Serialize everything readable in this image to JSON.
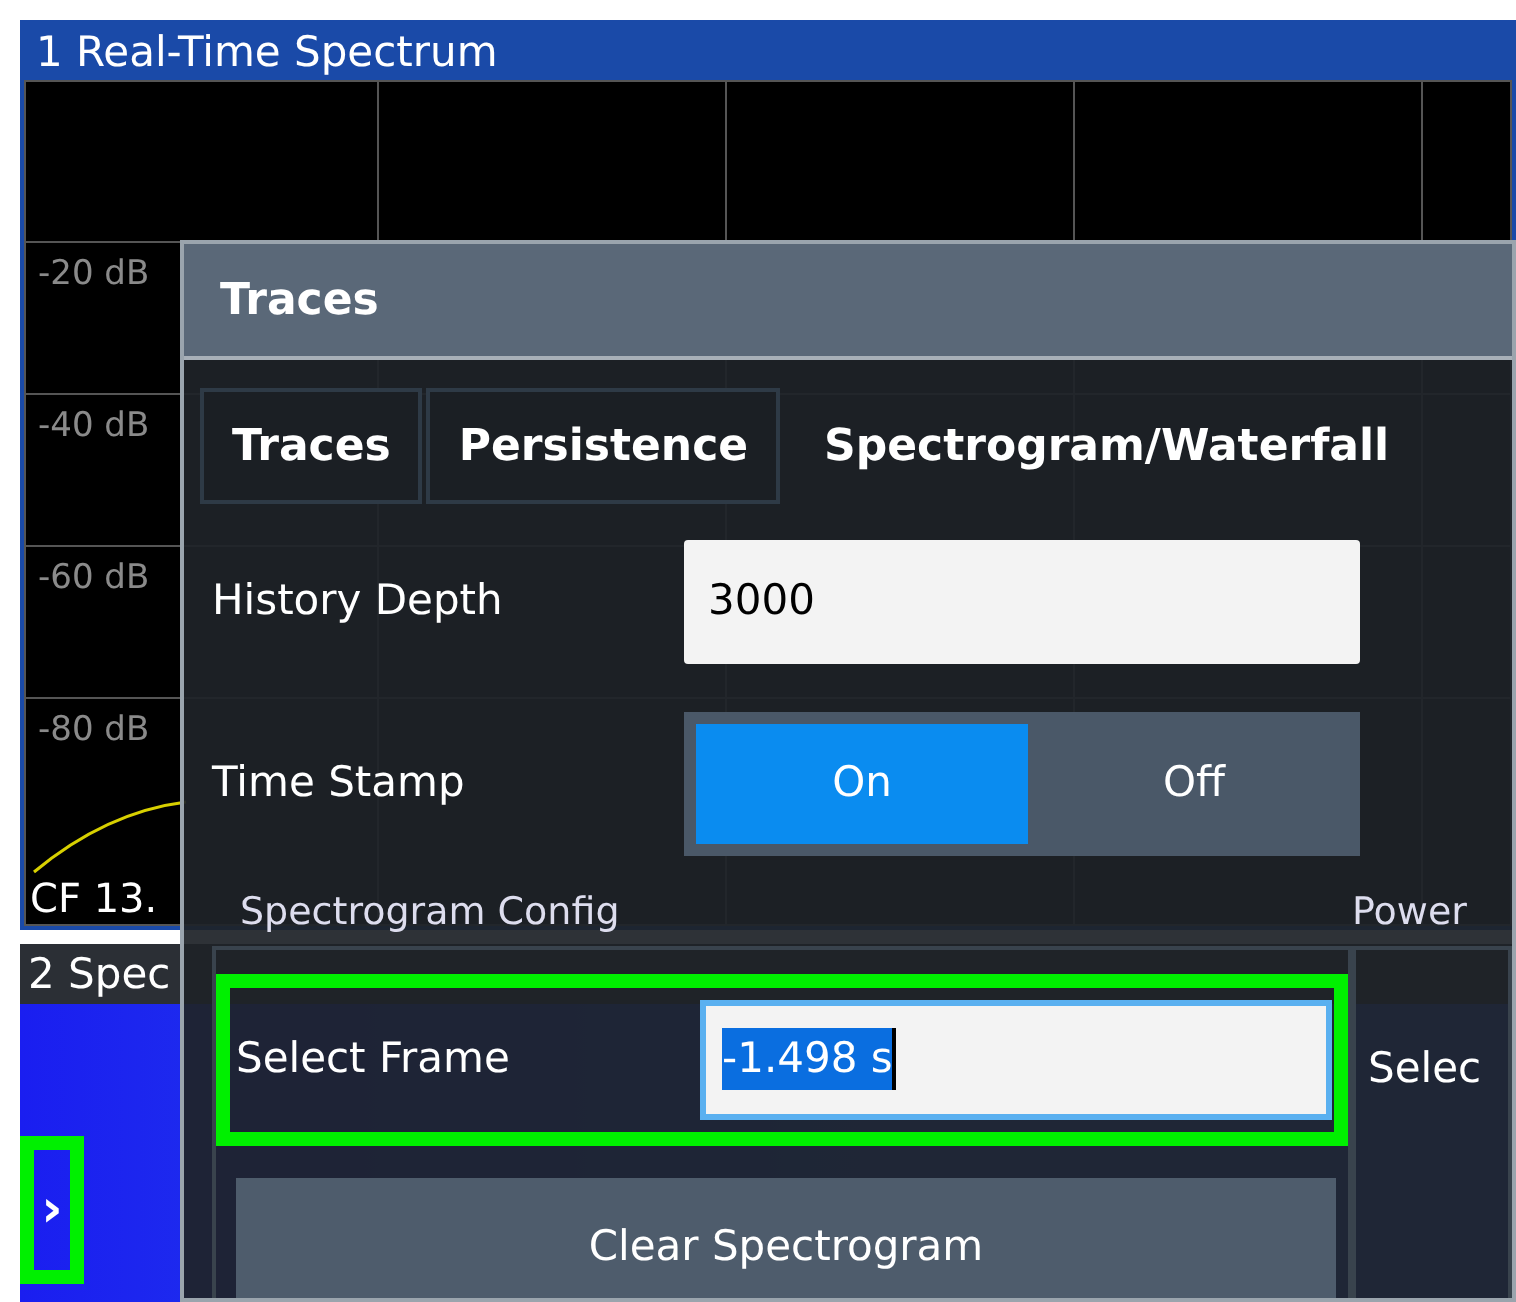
{
  "spectrum_window": {
    "title": "1 Real-Time Spectrum",
    "y_axis_labels": [
      "-20 dB",
      "-40 dB",
      "-60 dB",
      "-80 dB"
    ],
    "center_frequency": "CF 13."
  },
  "spectrogram_window": {
    "title": "2 Spec",
    "expand_handle": {
      "icon": "›",
      "highlighted": true
    }
  },
  "dialog": {
    "title": "Traces",
    "tabs": [
      {
        "label": "Traces",
        "selected": false
      },
      {
        "label": "Persistence",
        "selected": false
      },
      {
        "label": "Spectrogram/Waterfall",
        "selected": true
      }
    ],
    "history_depth": {
      "label": "History Depth",
      "value": "3000"
    },
    "time_stamp": {
      "label": "Time Stamp",
      "options": [
        {
          "label": "On",
          "selected": true
        },
        {
          "label": "Off",
          "selected": false
        }
      ]
    },
    "spectrogram_config": {
      "title": "Spectrogram Config",
      "select_frame": {
        "label": "Select Frame",
        "value": "-1.498 s",
        "highlighted": true
      },
      "clear_button": "Clear Spectrogram"
    },
    "power_group": {
      "title": "Power",
      "select_label": "Selec"
    }
  }
}
